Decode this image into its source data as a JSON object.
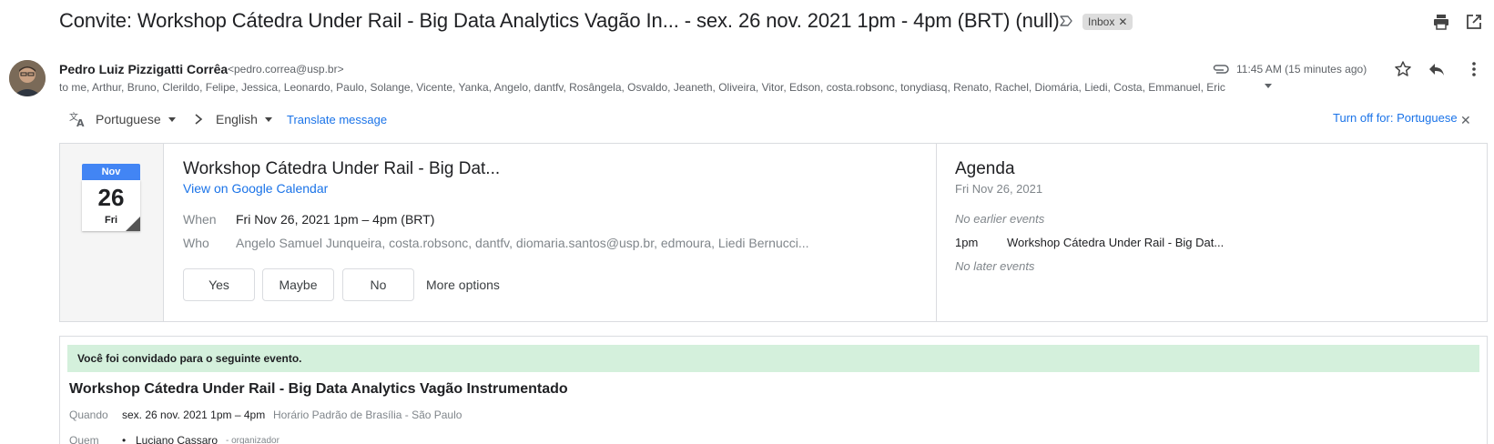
{
  "subject": {
    "text": "Convite: Workshop Cátedra Under Rail - Big Data Analytics Vagão In... - sex. 26 nov. 2021 1pm - 4pm (BRT) (null)",
    "label": "Inbox"
  },
  "sender": {
    "name": "Pedro Luiz Pizzigatti Corrêa",
    "email": "<pedro.correa@usp.br>",
    "recipients": "to me, Arthur, Bruno, Clerildo, Felipe, Jessica, Leonardo, Paulo, Solange, Vicente, Yanka, Angelo, dantfv, Rosângela, Osvaldo, Jeaneth, Oliveira, Vitor, Edson, costa.robsonc, tonydiasq, Renato, Rachel, Diomária, Liedi, Costa, Emmanuel, Eric",
    "time": "11:45 AM (15 minutes ago)"
  },
  "translate": {
    "source_lang": "Portuguese",
    "target_lang": "English",
    "translate_label": "Translate message",
    "turn_off_label": "Turn off for: Portuguese"
  },
  "calendar_card": {
    "month": "Nov",
    "day": "26",
    "weekday": "Fri",
    "event_title": "Workshop Cátedra Under Rail - Big Dat...",
    "view_calendar": "View on Google Calendar",
    "when_label": "When",
    "when_value": "Fri Nov 26, 2021 1pm – 4pm (BRT)",
    "who_label": "Who",
    "who_value": "Angelo Samuel Junqueira, costa.robsonc, dantfv, diomaria.santos@usp.br, edmoura, Liedi Bernucci...",
    "rsvp": {
      "yes": "Yes",
      "maybe": "Maybe",
      "no": "No",
      "more": "More options"
    }
  },
  "agenda": {
    "title": "Agenda",
    "date": "Fri Nov 26, 2021",
    "no_earlier": "No earlier events",
    "time": "1pm",
    "event": "Workshop Cátedra Under Rail - Big Dat...",
    "no_later": "No later events"
  },
  "invitation": {
    "banner": "Você foi convidado para o seguinte evento.",
    "title": "Workshop Cátedra Under Rail - Big Data Analytics Vagão Instrumentado",
    "quando_label": "Quando",
    "quando_value": "sex. 26 nov. 2021 1pm – 4pm",
    "quando_tz": "Horário Padrão de Brasília - São Paulo",
    "quem_label": "Quem",
    "organizer_name": "Luciano Cassaro",
    "organizer_role": "- organizador"
  },
  "colors": {
    "link": "#1a73e8",
    "calendar_blue": "#4285f4",
    "banner_green": "#d4f0dc"
  },
  "icons": [
    "important-icon",
    "print-icon",
    "open-new-window-icon",
    "attachment-icon",
    "star-icon",
    "reply-icon",
    "more-vert-icon",
    "translate-icon",
    "chevron-right-icon",
    "close-icon"
  ]
}
